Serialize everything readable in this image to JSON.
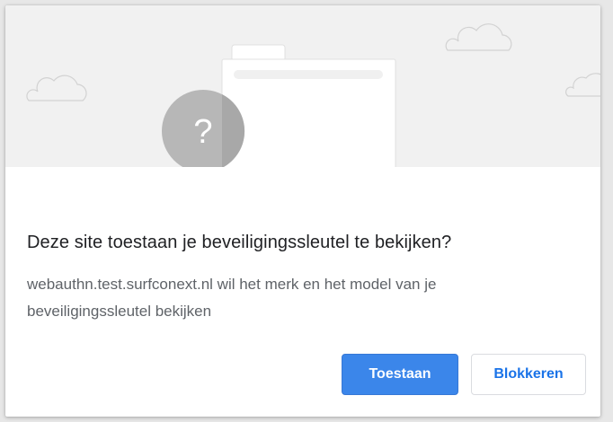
{
  "dialog": {
    "title": "Deze site toestaan je beveiligingssleutel te bekijken?",
    "body_line_1": "webauthn.test.surfconext.nl wil het merk en het model van je",
    "body_line_2": "beveiligingssleutel bekijken",
    "allow_label": "Toestaan",
    "block_label": "Blokkeren"
  },
  "illustration": {
    "question_glyph": "?",
    "icons": [
      "cloud-icon",
      "folder-icon",
      "question-mark-icon"
    ]
  },
  "colors": {
    "primary_button": "#3b86ea",
    "secondary_text": "#1a73e8",
    "illustration_bg": "#f1f1f1"
  }
}
